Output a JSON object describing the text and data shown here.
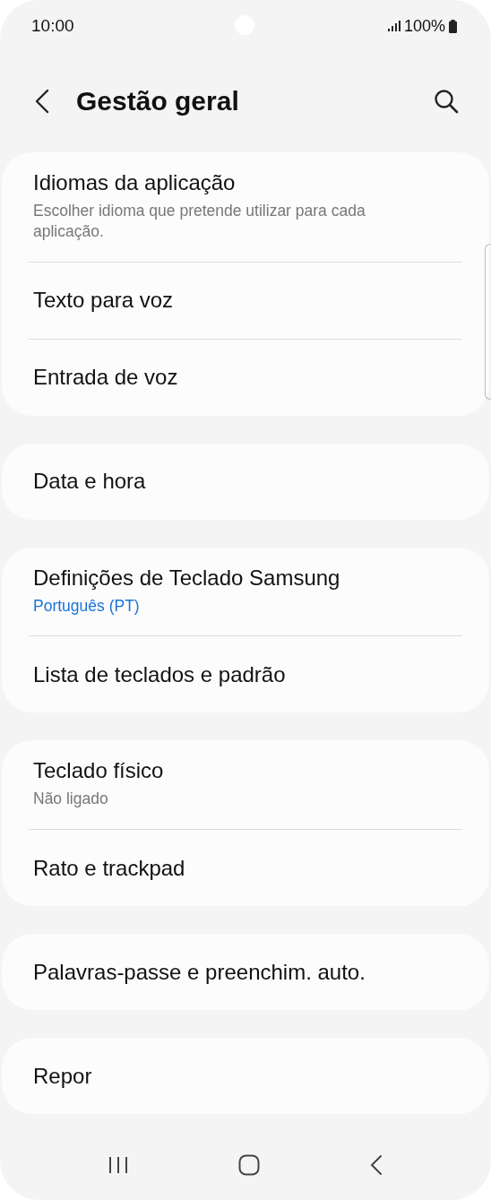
{
  "status_bar": {
    "time": "10:00",
    "battery": "100%"
  },
  "header": {
    "title": "Gestão geral"
  },
  "groups": [
    {
      "items": [
        {
          "kind": "summary",
          "label": "Idiomas da aplicação",
          "summary": "Escolher idioma que pretende utilizar para cada aplicação."
        },
        {
          "kind": "plain",
          "label": "Texto para voz"
        },
        {
          "kind": "plain",
          "label": "Entrada de voz"
        }
      ]
    },
    {
      "items": [
        {
          "kind": "plain",
          "label": "Data e hora"
        }
      ]
    },
    {
      "items": [
        {
          "kind": "value",
          "label": "Definições de Teclado Samsung",
          "summary": "Português (PT)"
        },
        {
          "kind": "plain",
          "label": "Lista de teclados e padrão"
        }
      ]
    },
    {
      "items": [
        {
          "kind": "summary",
          "label": "Teclado físico",
          "summary": "Não ligado"
        },
        {
          "kind": "plain",
          "label": "Rato e trackpad"
        }
      ]
    },
    {
      "items": [
        {
          "kind": "plain",
          "label": "Palavras-passe e preenchim. auto."
        }
      ]
    },
    {
      "items": [
        {
          "kind": "plain",
          "label": "Repor"
        }
      ]
    }
  ]
}
